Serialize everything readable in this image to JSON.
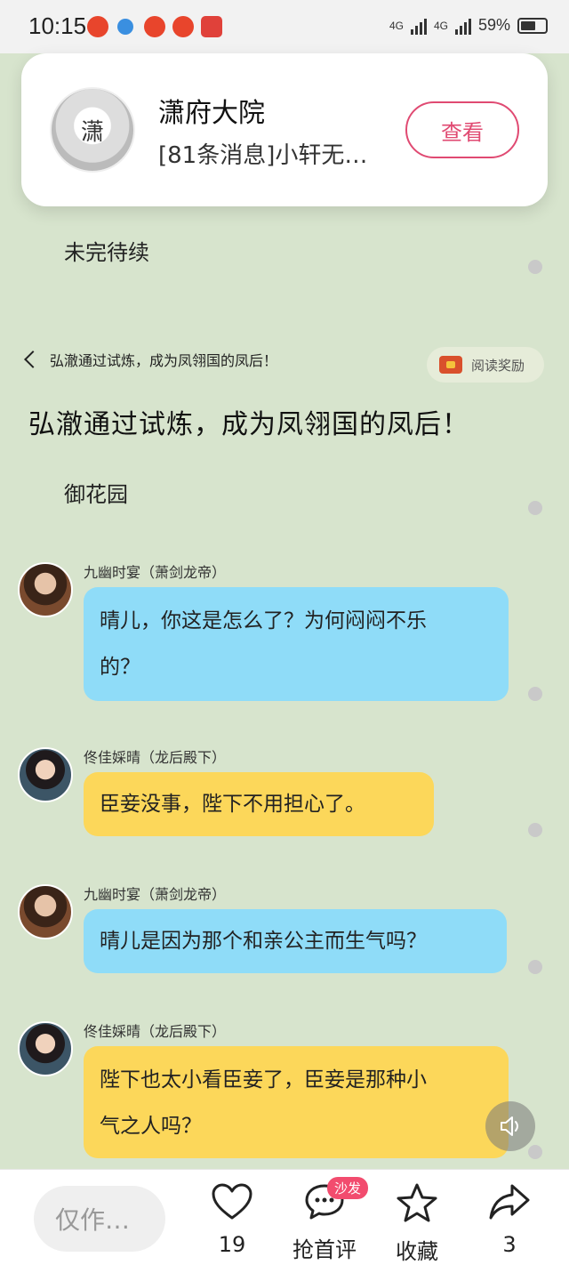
{
  "status_bar": {
    "time": "10:15",
    "network": "4G",
    "battery": "59%"
  },
  "notification": {
    "avatar_text": "潇",
    "title": "潇府大院",
    "message": "[81条消息]小轩无…",
    "button": "查看"
  },
  "story": {
    "previous_end": "未完待续",
    "chapter_nav": "弘澈通过试炼，成为凤翎国的凤后！",
    "reward_label": "阅读奖励",
    "chapter_title": "弘澈通过试炼，成为凤翎国的凤后！",
    "scene": "御花园",
    "messages": [
      {
        "speaker": "九幽时宴（萧剑龙帝）",
        "text_line1": "晴儿，你这是怎么了？为何闷闷不乐",
        "text_line2": "的？",
        "color": "#8fdcf8"
      },
      {
        "speaker": "佟佳婇晴（龙后殿下）",
        "text_line1": "臣妾没事，陛下不用担心了。",
        "color": "#fcd75a"
      },
      {
        "speaker": "九幽时宴（萧剑龙帝）",
        "text_line1": "晴儿是因为那个和亲公主而生气吗？",
        "color": "#8fdcf8"
      },
      {
        "speaker": "佟佳婇晴（龙后殿下）",
        "text_line1": "陛下也太小看臣妾了，臣妾是那种小",
        "text_line2": "气之人吗？",
        "color": "#fcd75a"
      }
    ]
  },
  "bottom_bar": {
    "comment_placeholder": "仅作…",
    "likes": "19",
    "sofa_badge": "沙发",
    "first_comment": "抢首评",
    "favorite": "收藏",
    "shares": "3"
  }
}
